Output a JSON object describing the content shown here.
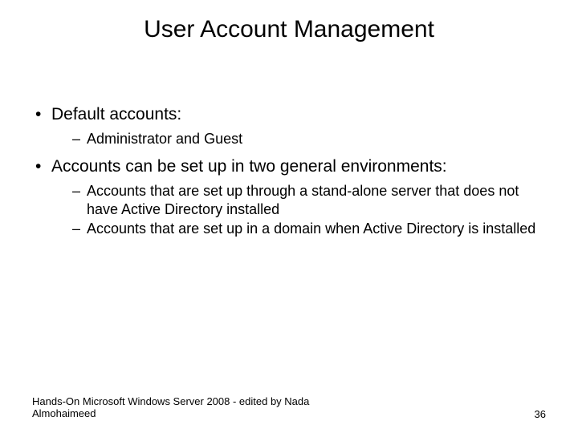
{
  "title": "User Account Management",
  "bullets": {
    "b1": "Default accounts:",
    "b1_sub1": "Administrator and Guest",
    "b2": "Accounts can be set up in two general environments:",
    "b2_sub1": "Accounts that are set up through a stand-alone server that does not have Active Directory installed",
    "b2_sub2": "Accounts that are set up in a domain when Active Directory is installed"
  },
  "footer": {
    "left": "Hands-On Microsoft Windows Server 2008 - edited  by Nada Almohaimeed",
    "page": "36"
  }
}
